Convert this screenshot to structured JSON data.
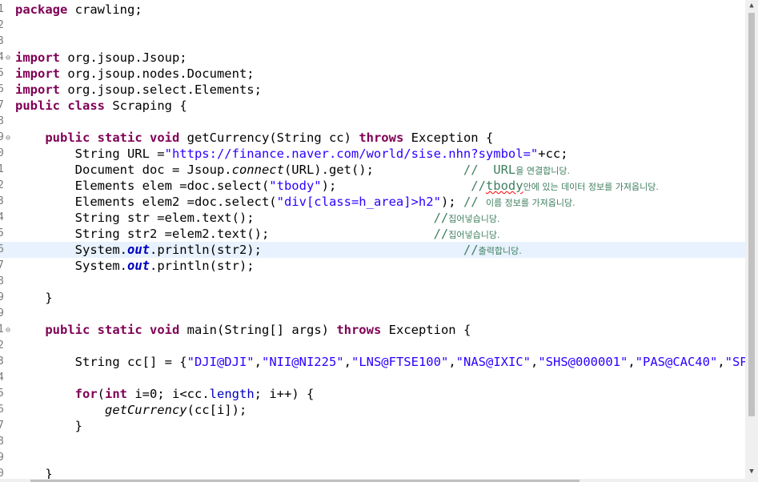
{
  "editor": {
    "line_numbers": [
      "1",
      "2",
      "3",
      "4",
      "5",
      "6",
      "7",
      "8",
      "9",
      "0",
      "1",
      "2",
      "3",
      "4",
      "5",
      "6",
      "7",
      "8",
      "9",
      "1",
      "2",
      "3",
      "4",
      "5",
      "6",
      "7",
      "8",
      "9",
      "0"
    ],
    "fold_markers": {
      "4": "⊖",
      "9": "⊖",
      "1": "⊖"
    },
    "code": {
      "l1_kw": "package",
      "l1_rest": " crawling;",
      "import_kw": "import",
      "l4_rest": " org.jsoup.Jsoup;",
      "l5_rest": " org.jsoup.nodes.Document;",
      "l6_rest": " org.jsoup.select.Elements;",
      "public_kw": "public",
      "class_kw": "class",
      "l7_rest": " Scraping {",
      "static_kw": "static",
      "void_kw": "void",
      "throws_kw": "throws",
      "l9_sig": " getCurrency(String cc) ",
      "l9_tail": " Exception {",
      "l10_a": "        String URL =",
      "l10_str": "\"https://finance.naver.com/world/sise.nhn?symbol=\"",
      "l10_b": "+cc;",
      "l11_a": "        Document doc = Jsoup.",
      "l11_m": "connect",
      "l11_b": "(URL).get();            ",
      "l11_c1": "//  URL",
      "l11_c2": "을 연결합니당.",
      "l12_a": "        Elements elem =doc.select(",
      "l12_str": "\"tbody\"",
      "l12_b": ");                  ",
      "l12_c1": "//",
      "l12_c2": "tbody",
      "l12_c3": "안에 있는 데이터 정보를 가져옵니당.",
      "l13_a": "        Elements elem2 =doc.select(",
      "l13_str": "\"div[class=h_area]>h2\"",
      "l13_b": "); ",
      "l13_c1": "// ",
      "l13_c2": "이름 정보를 가져옵니당.",
      "l14_a": "        String str =elem.text();                        ",
      "c_slash": "//",
      "c_put": "집어넣습니당.",
      "c_print": "출력합니당.",
      "l15_a": "        String str2 =elem2.text();                      ",
      "sys_a": "        System.",
      "out": "out",
      "l16_b": ".println(str2);                           ",
      "l17_b": ".println(str);",
      "l19": "    }",
      "l21_sig": " main(String[] args) ",
      "l21_tail": " Exception {",
      "l23_a": "        String cc[] = {",
      "l23_s1": "\"DJI@DJI\"",
      "l23_s2": "\"NII@NI225\"",
      "l23_s3": "\"LNS@FTSE100\"",
      "l23_s4": "\"NAS@IXIC\"",
      "l23_s5": "\"SHS@000001\"",
      "l23_s6": "\"PAS@CAC40\"",
      "l23_s7": "\"SPI@S",
      "comma": ",",
      "for_kw": "for",
      "int_kw": "int",
      "l25_a": "(",
      "l25_b": " i=0; i<cc.",
      "l25_len": "length",
      "l25_c": "; i++) {",
      "l26_m": "getCurrency",
      "l26_b": "(cc[i]);",
      "l27": "        }",
      "l30": "    }"
    }
  }
}
